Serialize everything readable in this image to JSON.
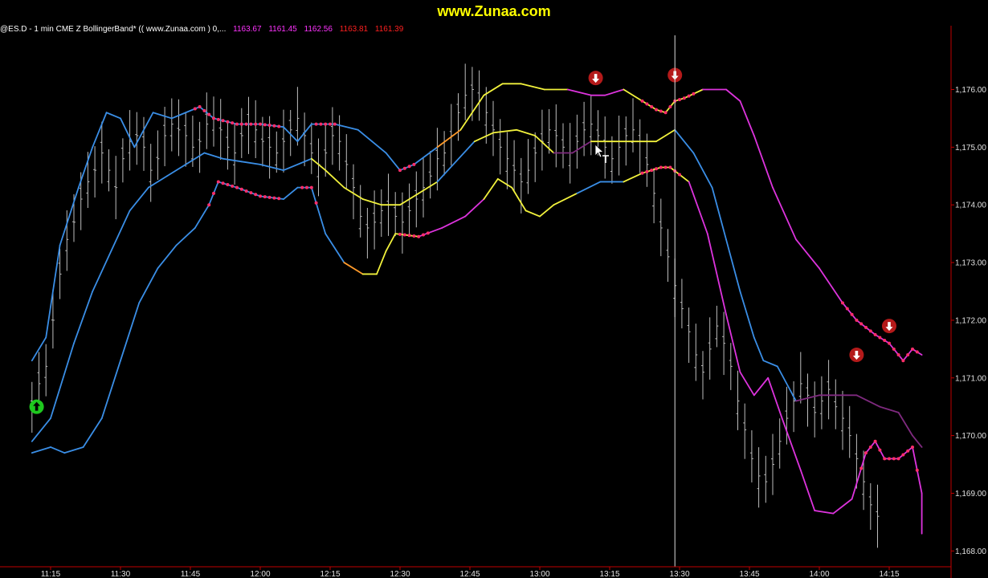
{
  "site_title": "www.Zunaa.com",
  "info": {
    "symbol": "@ES.D - 1 min  CME  Z BollingerBand* (( www.Zunaa.com )  0,...",
    "v1": "1163.67",
    "v2": "1161.45",
    "v3": "1162.56",
    "v4": "1163.81",
    "v5": "1161.39",
    "c_symbol": "#ffffff",
    "c_v1": "#ff33ff",
    "c_v2": "#ff33ff",
    "c_v3": "#ff33ff",
    "c_v4": "#ff2020",
    "c_v5": "#ff2020"
  },
  "chart_data": {
    "type": "line",
    "title": "",
    "xlabel": "",
    "ylabel": "",
    "y_range": [
      1167.9,
      1177.0
    ],
    "x_ticks": [
      "11:15",
      "11:30",
      "11:45",
      "12:00",
      "12:15",
      "12:30",
      "12:45",
      "13:00",
      "13:15",
      "13:30",
      "13:45",
      "14:00",
      "14:15"
    ],
    "y_ticks": [
      "1,168.00",
      "1,169.00",
      "1,170.00",
      "1,171.00",
      "1,172.00",
      "1,173.00",
      "1,174.00",
      "1,175.00",
      "1,176.00"
    ],
    "y_tick_values": [
      1168,
      1169,
      1170,
      1171,
      1172,
      1173,
      1174,
      1175,
      1176
    ],
    "time_range": [
      "11:11",
      "14:22"
    ],
    "cursor_time": "13:29",
    "colors": {
      "blue": "#3a8ee6",
      "yellow": "#f2f23c",
      "magenta": "#dd33dd",
      "purple": "#7f2a7f",
      "orange": "#ff9a2a",
      "dot": "#ff2e6a",
      "bar": "#bdbdbd",
      "axis": "#c00000",
      "cursor": "#dddddd"
    },
    "series": [
      {
        "key": "upper",
        "points": [
          [
            "11:11",
            1171.3
          ],
          [
            "11:14",
            1171.7
          ],
          [
            "11:17",
            1173.3
          ],
          [
            "11:21",
            1174.3
          ],
          [
            "11:24",
            1175.0
          ],
          [
            "11:27",
            1175.6
          ],
          [
            "11:30",
            1175.5
          ],
          [
            "11:33",
            1175.0
          ],
          [
            "11:37",
            1175.6
          ],
          [
            "11:41",
            1175.5
          ],
          [
            "11:44",
            1175.6
          ],
          [
            "11:47",
            1175.7
          ],
          [
            "11:50",
            1175.5
          ],
          [
            "11:55",
            1175.4
          ],
          [
            "12:00",
            1175.4
          ],
          [
            "12:05",
            1175.35
          ],
          [
            "12:08",
            1175.1
          ],
          [
            "12:11",
            1175.4
          ],
          [
            "12:16",
            1175.4
          ],
          [
            "12:21",
            1175.3
          ],
          [
            "12:24",
            1175.1
          ],
          [
            "12:27",
            1174.9
          ],
          [
            "12:30",
            1174.6
          ],
          [
            "12:33",
            1174.7
          ],
          [
            "12:38",
            1175.0
          ],
          [
            "12:43",
            1175.3
          ],
          [
            "12:48",
            1175.9
          ],
          [
            "12:52",
            1176.1
          ],
          [
            "12:56",
            1176.1
          ],
          [
            "13:01",
            1176.0
          ],
          [
            "13:06",
            1176.0
          ],
          [
            "13:11",
            1175.9
          ],
          [
            "13:14",
            1175.9
          ],
          [
            "13:18",
            1176.0
          ],
          [
            "13:22",
            1175.8
          ],
          [
            "13:25",
            1175.65
          ],
          [
            "13:27",
            1175.6
          ],
          [
            "13:29",
            1175.8
          ],
          [
            "13:31",
            1175.85
          ],
          [
            "13:35",
            1176.0
          ],
          [
            "13:40",
            1176.0
          ],
          [
            "13:43",
            1175.8
          ],
          [
            "13:46",
            1175.2
          ],
          [
            "13:50",
            1174.3
          ],
          [
            "13:55",
            1173.4
          ],
          [
            "14:00",
            1172.9
          ],
          [
            "14:05",
            1172.3
          ],
          [
            "14:08",
            1172.0
          ],
          [
            "14:12",
            1171.75
          ],
          [
            "14:15",
            1171.6
          ],
          [
            "14:18",
            1171.3
          ],
          [
            "14:20",
            1171.5
          ],
          [
            "14:22",
            1171.4
          ]
        ]
      },
      {
        "key": "middle",
        "points": [
          [
            "11:11",
            1169.9
          ],
          [
            "11:15",
            1170.3
          ],
          [
            "11:20",
            1171.6
          ],
          [
            "11:24",
            1172.5
          ],
          [
            "11:28",
            1173.2
          ],
          [
            "11:32",
            1173.9
          ],
          [
            "11:36",
            1174.3
          ],
          [
            "11:40",
            1174.5
          ],
          [
            "11:44",
            1174.7
          ],
          [
            "11:48",
            1174.9
          ],
          [
            "11:52",
            1174.8
          ],
          [
            "11:56",
            1174.75
          ],
          [
            "12:00",
            1174.7
          ],
          [
            "12:05",
            1174.6
          ],
          [
            "12:11",
            1174.8
          ],
          [
            "12:14",
            1174.6
          ],
          [
            "12:18",
            1174.3
          ],
          [
            "12:22",
            1174.1
          ],
          [
            "12:26",
            1174.0
          ],
          [
            "12:30",
            1174.0
          ],
          [
            "12:34",
            1174.2
          ],
          [
            "12:38",
            1174.4
          ],
          [
            "12:42",
            1174.75
          ],
          [
            "12:46",
            1175.1
          ],
          [
            "12:50",
            1175.25
          ],
          [
            "12:55",
            1175.3
          ],
          [
            "12:59",
            1175.2
          ],
          [
            "13:03",
            1174.9
          ],
          [
            "13:07",
            1174.9
          ],
          [
            "13:11",
            1175.1
          ],
          [
            "13:16",
            1175.1
          ],
          [
            "13:21",
            1175.1
          ],
          [
            "13:25",
            1175.1
          ],
          [
            "13:29",
            1175.3
          ],
          [
            "13:33",
            1174.9
          ],
          [
            "13:37",
            1174.3
          ],
          [
            "13:40",
            1173.4
          ],
          [
            "13:43",
            1172.5
          ],
          [
            "13:46",
            1171.7
          ],
          [
            "13:48",
            1171.3
          ],
          [
            "13:51",
            1171.2
          ],
          [
            "13:55",
            1170.6
          ],
          [
            "14:00",
            1170.7
          ],
          [
            "14:04",
            1170.7
          ],
          [
            "14:08",
            1170.7
          ],
          [
            "14:13",
            1170.5
          ],
          [
            "14:17",
            1170.4
          ],
          [
            "14:20",
            1170.0
          ],
          [
            "14:22",
            1169.8
          ]
        ]
      },
      {
        "key": "lower",
        "points": [
          [
            "11:11",
            1169.7
          ],
          [
            "11:15",
            1169.8
          ],
          [
            "11:18",
            1169.7
          ],
          [
            "11:22",
            1169.8
          ],
          [
            "11:26",
            1170.3
          ],
          [
            "11:30",
            1171.3
          ],
          [
            "11:34",
            1172.3
          ],
          [
            "11:38",
            1172.9
          ],
          [
            "11:42",
            1173.3
          ],
          [
            "11:46",
            1173.6
          ],
          [
            "11:49",
            1174.0
          ],
          [
            "11:51",
            1174.4
          ],
          [
            "11:55",
            1174.3
          ],
          [
            "12:00",
            1174.15
          ],
          [
            "12:05",
            1174.1
          ],
          [
            "12:08",
            1174.3
          ],
          [
            "12:11",
            1174.3
          ],
          [
            "12:14",
            1173.5
          ],
          [
            "12:18",
            1173.0
          ],
          [
            "12:22",
            1172.8
          ],
          [
            "12:25",
            1172.8
          ],
          [
            "12:27",
            1173.2
          ],
          [
            "12:29",
            1173.5
          ],
          [
            "12:34",
            1173.45
          ],
          [
            "12:39",
            1173.6
          ],
          [
            "12:44",
            1173.8
          ],
          [
            "12:48",
            1174.1
          ],
          [
            "12:51",
            1174.45
          ],
          [
            "12:54",
            1174.3
          ],
          [
            "12:57",
            1173.9
          ],
          [
            "13:00",
            1173.8
          ],
          [
            "13:03",
            1174.0
          ],
          [
            "13:08",
            1174.2
          ],
          [
            "13:13",
            1174.4
          ],
          [
            "13:18",
            1174.4
          ],
          [
            "13:22",
            1174.55
          ],
          [
            "13:26",
            1174.65
          ],
          [
            "13:28",
            1174.65
          ],
          [
            "13:32",
            1174.4
          ],
          [
            "13:36",
            1173.5
          ],
          [
            "13:40",
            1172.1
          ],
          [
            "13:43",
            1171.1
          ],
          [
            "13:46",
            1170.7
          ],
          [
            "13:49",
            1171.0
          ],
          [
            "13:52",
            1170.3
          ],
          [
            "13:56",
            1169.4
          ],
          [
            "13:59",
            1168.7
          ],
          [
            "14:03",
            1168.65
          ],
          [
            "14:07",
            1168.9
          ],
          [
            "14:10",
            1169.7
          ],
          [
            "14:12",
            1169.9
          ],
          [
            "14:14",
            1169.6
          ],
          [
            "14:17",
            1169.6
          ],
          [
            "14:20",
            1169.8
          ],
          [
            "14:22",
            1169.0
          ],
          [
            "14:22",
            1168.3
          ]
        ]
      }
    ],
    "bars": {
      "start": "11:11",
      "end": "14:21",
      "spacing_min": 1,
      "walk": [
        1170.6,
        1170.9,
        1171.2,
        1172.0,
        1172.8,
        1173.4,
        1173.7,
        1174.1,
        1174.4,
        1174.6,
        1174.9,
        1174.6,
        1174.3,
        1174.8,
        1175.1,
        1175.2,
        1175.0,
        1174.6,
        1174.8,
        1175.2,
        1175.4,
        1175.3,
        1175.2,
        1175.0,
        1175.1,
        1175.4,
        1175.5,
        1175.3,
        1175.0,
        1174.9,
        1175.2,
        1175.4,
        1175.3,
        1175.1,
        1175.0,
        1174.9,
        1175.1,
        1175.3,
        1175.5,
        1175.2,
        1174.9,
        1174.7,
        1174.9,
        1175.2,
        1175.1,
        1174.7,
        1174.3,
        1173.8,
        1173.6,
        1173.7,
        1173.9,
        1174.0,
        1173.8,
        1173.7,
        1173.9,
        1174.1,
        1174.3,
        1174.5,
        1174.8,
        1174.9,
        1175.2,
        1175.6,
        1175.9,
        1176.0,
        1175.8,
        1175.6,
        1175.3,
        1175.0,
        1174.8,
        1174.6,
        1174.4,
        1174.6,
        1174.9,
        1175.1,
        1175.3,
        1175.2,
        1175.0,
        1174.9,
        1175.1,
        1175.3,
        1175.4,
        1175.2,
        1175.0,
        1174.8,
        1175.0,
        1175.2,
        1175.3,
        1175.1,
        1174.7,
        1174.2,
        1173.6,
        1173.1,
        1172.6,
        1172.2,
        1171.8,
        1171.4,
        1171.1,
        1171.5,
        1171.9,
        1171.6,
        1171.2,
        1170.6,
        1170.1,
        1169.6,
        1169.3,
        1169.2,
        1169.5,
        1169.9,
        1170.3,
        1170.6,
        1170.9,
        1170.7,
        1170.4,
        1170.6,
        1170.8,
        1170.5,
        1170.3,
        1170.0,
        1169.6,
        1169.2,
        1168.8,
        1168.6
      ],
      "range": 0.55
    },
    "markers": [
      {
        "type": "up",
        "time": "11:12",
        "value": 1170.5,
        "color": "#1ec81e"
      },
      {
        "type": "down",
        "time": "13:12",
        "value": 1176.2,
        "color": "#b41a1a"
      },
      {
        "type": "down",
        "time": "13:29",
        "value": 1176.25,
        "color": "#b41a1a"
      },
      {
        "type": "down",
        "time": "14:08",
        "value": 1171.4,
        "color": "#b41a1a"
      },
      {
        "type": "down",
        "time": "14:15",
        "value": 1171.9,
        "color": "#b41a1a"
      }
    ]
  }
}
